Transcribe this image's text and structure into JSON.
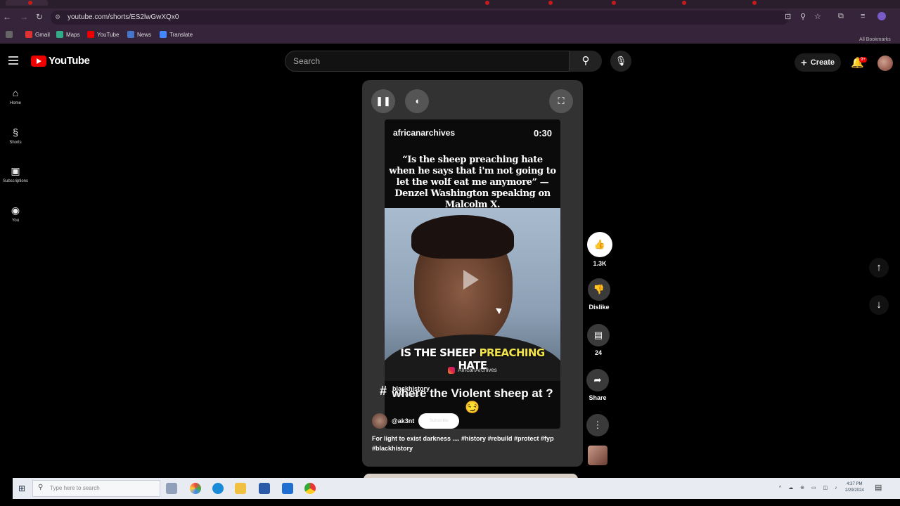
{
  "browser": {
    "url": "youtube.com/shorts/ES2lwGwXQx0",
    "bookmarks": [
      {
        "label": "Gmail",
        "color": "#d33"
      },
      {
        "label": "Maps",
        "color": "#3a8"
      },
      {
        "label": "YouTube",
        "color": "#e00"
      },
      {
        "label": "News",
        "color": "#47c"
      },
      {
        "label": "Translate",
        "color": "#48f"
      }
    ],
    "all_bookmarks": "All Bookmarks"
  },
  "header": {
    "logo_text": "YouTube",
    "search_placeholder": "Search",
    "create_label": "Create",
    "notification_count": "9+"
  },
  "sidebar": {
    "items": [
      {
        "label": "Home",
        "icon": "home-icon"
      },
      {
        "label": "Shorts",
        "icon": "shorts-icon"
      },
      {
        "label": "Subscriptions",
        "icon": "subscriptions-icon"
      },
      {
        "label": "You",
        "icon": "you-icon"
      }
    ]
  },
  "short": {
    "video_channel": "africanarchives",
    "time": "0:30",
    "quote": "“Is the sheep preaching hate when he says that i'm not going to let the wolf eat me anymore” —Denzel Washington speaking on Malcolm X.",
    "caption_before": "IS THE SHEEP ",
    "caption_highlight": "PREACHING",
    "caption_after": " HATE",
    "watermark": "AfricanArchives",
    "overlay_text": "where the Violent sheep at ?😏",
    "hashtag_name": "blackhistory",
    "hashtag_sub": "116K videos",
    "channel_handle": "@ak3nt",
    "subscribe_label": "Subscribe",
    "description": "For light to exist darkness .... #history #rebuild #protect #fyp #blackhistory"
  },
  "actions": {
    "likes": "1.3K",
    "dislike_label": "Dislike",
    "comments": "24",
    "share_label": "Share"
  },
  "taskbar": {
    "search_placeholder": "Type here to search",
    "time": "4:37 PM",
    "date": "2/29/2024"
  },
  "colors": {
    "youtube_red": "#ff0000",
    "caption_highlight": "#f2e34a",
    "card_bg": "#323232"
  }
}
